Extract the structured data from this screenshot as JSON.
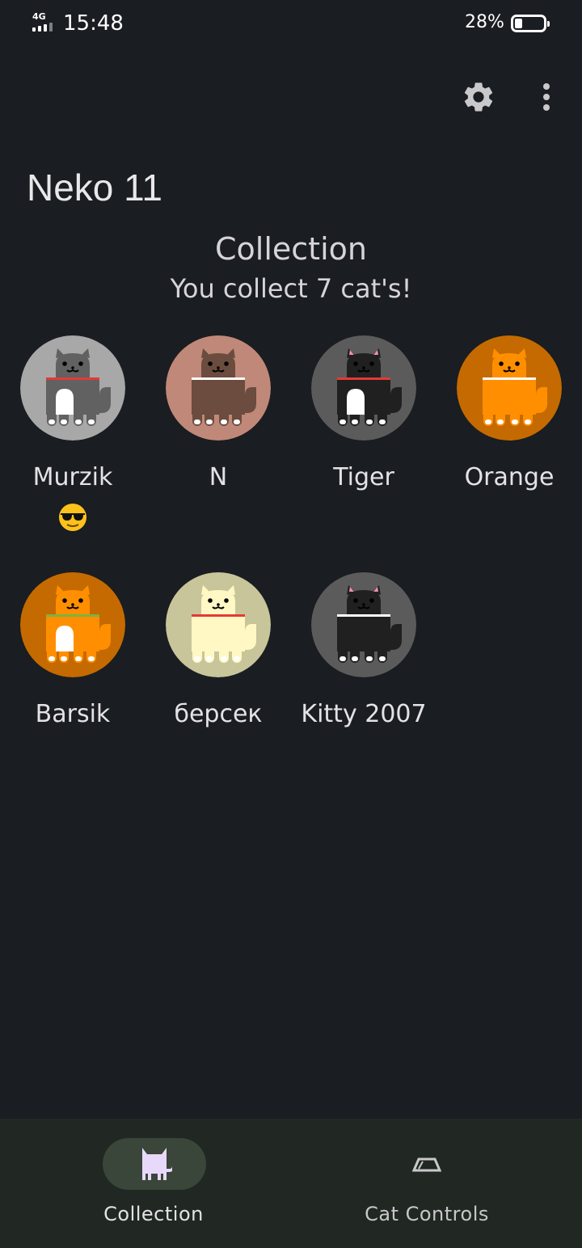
{
  "status_bar": {
    "network": "4G",
    "time": "15:48",
    "battery": "28%",
    "battery_level": 0.28
  },
  "toolbar": {
    "settings_icon": "gear-icon",
    "more_icon": "more-vert-icon"
  },
  "app": {
    "title": "Neko 11"
  },
  "collection": {
    "title": "Collection",
    "subtitle": "You collect 7 cat's!",
    "cats": [
      {
        "name": "Murzik",
        "emoji": "😎",
        "bg": "#a8a8a8",
        "body": "#616161",
        "collar": "#e53935",
        "belly": "#ffffff",
        "ear": "#616161"
      },
      {
        "name": "N",
        "bg": "#c08878",
        "body": "#6b4c3e",
        "collar": "#ffffff",
        "belly": "",
        "ear": "#6b4c3e"
      },
      {
        "name": "Tiger",
        "bg": "#5b5b5b",
        "body": "#202020",
        "collar": "#e53935",
        "belly": "#ffffff",
        "ear": "#f48fb1"
      },
      {
        "name": "Orange",
        "bg": "#c56a00",
        "body": "#ff8f00",
        "collar": "#ffffff",
        "belly": "",
        "ear": "#ff8f00"
      },
      {
        "name": "Barsik",
        "bg": "#c56a00",
        "body": "#ff8f00",
        "collar": "#7cb342",
        "belly": "#ffffff",
        "ear": "#ff8f00"
      },
      {
        "name": "берсек",
        "bg": "#c8c59a",
        "body": "#fff8c4",
        "collar": "#e53935",
        "belly": "",
        "ear": "#fff8c4"
      },
      {
        "name": "Kitty 2007",
        "bg": "#5b5b5b",
        "body": "#202020",
        "collar": "#ffffff",
        "belly": "",
        "ear": "#f48fb1"
      }
    ]
  },
  "bottom_nav": {
    "items": [
      {
        "label": "Collection",
        "icon": "cat-icon",
        "active": true
      },
      {
        "label": "Cat Controls",
        "icon": "food-bowl-icon",
        "active": false
      }
    ]
  }
}
